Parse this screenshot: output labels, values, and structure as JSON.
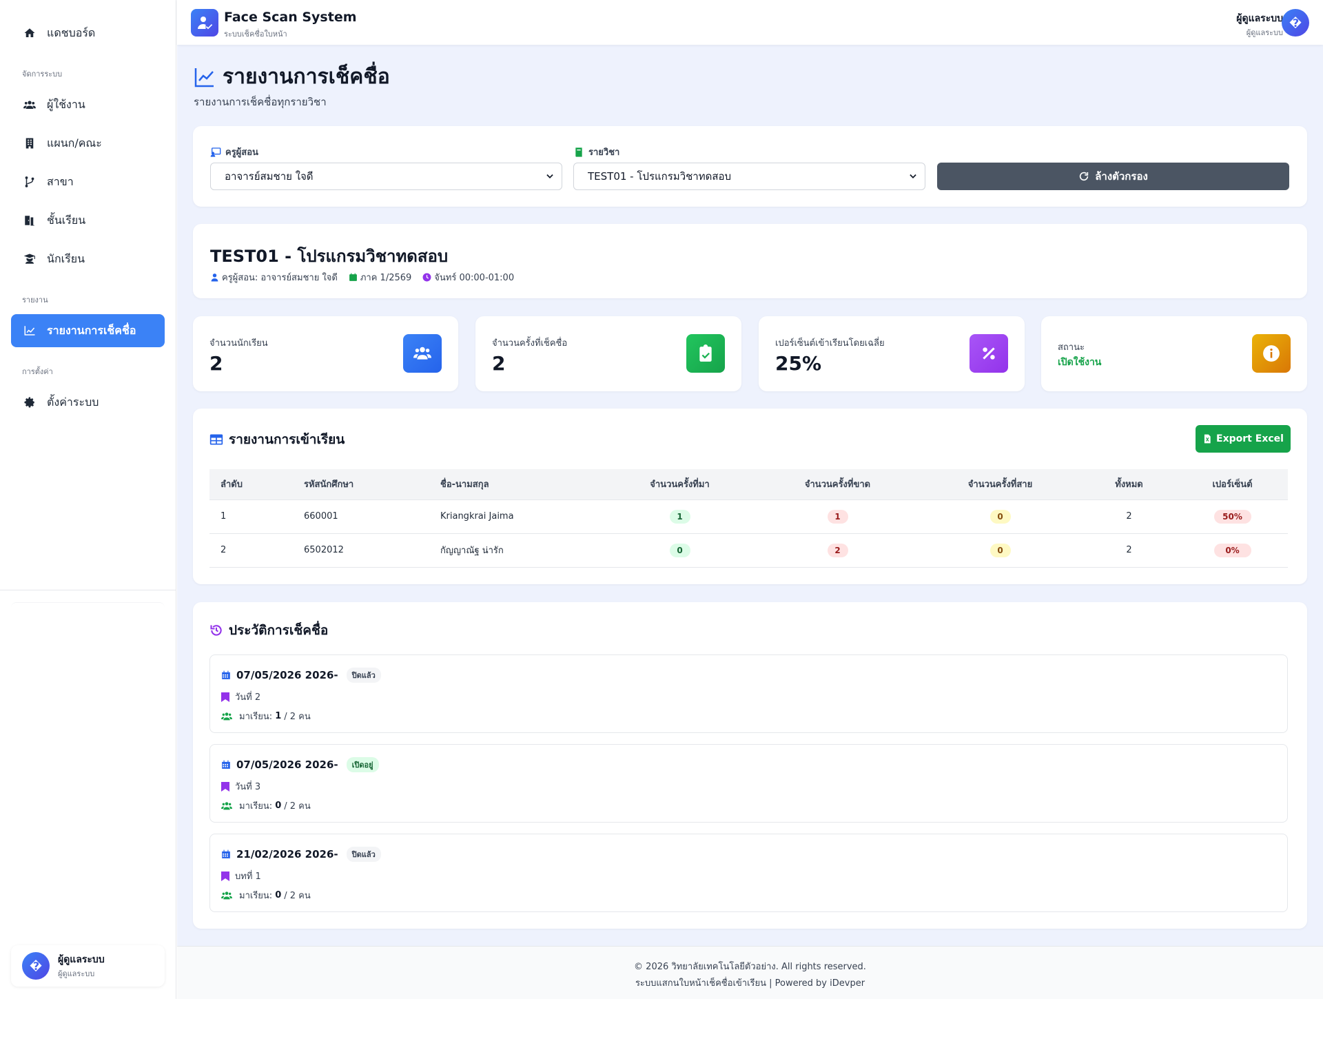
{
  "colors": {
    "accent": "#3b82f6",
    "success": "#16a34a",
    "danger": "#dc2626",
    "dark_button": "#4b5563",
    "purple": "#9333ea",
    "amber": "#d97706"
  },
  "sidebar": {
    "items": [
      {
        "label": "แดชบอร์ด",
        "icon": "home-icon"
      },
      {
        "section": "จัดการระบบ"
      },
      {
        "label": "ผู้ใช้งาน",
        "icon": "users-icon"
      },
      {
        "label": "แผนก/คณะ",
        "icon": "building-icon"
      },
      {
        "label": "สาขา",
        "icon": "branch-icon"
      },
      {
        "label": "ชั้นเรียน",
        "icon": "door-icon"
      },
      {
        "label": "นักเรียน",
        "icon": "graduate-icon"
      },
      {
        "section": "รายงาน"
      },
      {
        "label": "รายงานการเช็คชื่อ",
        "icon": "chart-line-icon",
        "active": true
      },
      {
        "section": "การตั้งค่า"
      },
      {
        "label": "ตั้งค่าระบบ",
        "icon": "gear-icon"
      }
    ],
    "user": {
      "avatar": "�",
      "name": "ผู้ดูแลระบบ",
      "role": "ผู้ดูแลระบบ"
    }
  },
  "header": {
    "app_title": "Face Scan System",
    "app_subtitle": "ระบบเช็คชื่อใบหน้า",
    "user_name": "ผู้ดูแลระบบ",
    "user_role": "ผู้ดูแลระบบ",
    "avatar": "�"
  },
  "page": {
    "title": "รายงานการเช็คชื่อ",
    "subtitle": "รายงานการเช็คชื่อทุกรายวิชา"
  },
  "filters": {
    "teacher_label": "ครูผู้สอน",
    "teacher_value": "อาจารย์สมชาย ใจดี",
    "course_label": "รายวิชา",
    "course_value": "TEST01 - โปรแกรมวิชาทดสอบ",
    "reset_label": "ล้างตัวกรอง"
  },
  "course": {
    "title": "TEST01 - โปรแกรมวิชาทดสอบ",
    "teacher": "ครูผู้สอน: อาจารย์สมชาย ใจดี",
    "term": "ภาค 1/2569",
    "schedule": "จันทร์ 00:00-01:00"
  },
  "stats": [
    {
      "label": "จำนวนนักเรียน",
      "value": "2",
      "icon": "users-icon",
      "color": "#3b82f6"
    },
    {
      "label": "จำนวนครั้งที่เช็คชื่อ",
      "value": "2",
      "icon": "clipboard-check-icon",
      "color": "#22c55e"
    },
    {
      "label": "เปอร์เซ็นต์เข้าเรียนโดยเฉลี่ย",
      "value": "25%",
      "icon": "percent-icon",
      "color": "#a855f7"
    },
    {
      "label": "สถานะ",
      "value": "เปิดใช้งาน",
      "icon": "info-icon",
      "color": "#eab308"
    }
  ],
  "attendance": {
    "title": "รายงานการเข้าเรียน",
    "export_label": "Export Excel",
    "columns": [
      "ลำดับ",
      "รหัสนักศึกษา",
      "ชื่อ-นามสกุล",
      "จำนวนครั้งที่มา",
      "จำนวนครั้งที่ขาด",
      "จำนวนครั้งที่สาย",
      "ทั้งหมด",
      "เปอร์เซ็นต์"
    ],
    "rows": [
      {
        "no": "1",
        "id": "660001",
        "name": "Kriangkrai Jaima",
        "present": "1",
        "absent": "1",
        "late": "0",
        "total": "2",
        "percent": "50%"
      },
      {
        "no": "2",
        "id": "6502012",
        "name": "กัญญาณัฐ น่ารัก",
        "present": "0",
        "absent": "2",
        "late": "0",
        "total": "2",
        "percent": "0%"
      }
    ]
  },
  "history": {
    "title": "ประวัติการเช็คชื่อ",
    "items": [
      {
        "date": "07/05/2026 2026-",
        "status": "ปิดแล้ว",
        "status_type": "closed",
        "session": "วันที่ 2",
        "count_label": "มาเรียน:",
        "count_present": "1",
        "count_rest": "/ 2 คน"
      },
      {
        "date": "07/05/2026 2026-",
        "status": "เปิดอยู่",
        "status_type": "open",
        "session": "วันที่ 3",
        "count_label": "มาเรียน:",
        "count_present": "0",
        "count_rest": "/ 2 คน"
      },
      {
        "date": "21/02/2026 2026-",
        "status": "ปิดแล้ว",
        "status_type": "closed",
        "session": "บทที่ 1",
        "count_label": "มาเรียน:",
        "count_present": "0",
        "count_rest": "/ 2 คน"
      }
    ]
  },
  "footer": {
    "line1": "© 2026 วิทยาลัยเทคโนโลยีตัวอย่าง. All rights reserved.",
    "line2": "ระบบแสกนใบหน้าเช็คชื่อเข้าเรียน | Powered by iDevper"
  }
}
